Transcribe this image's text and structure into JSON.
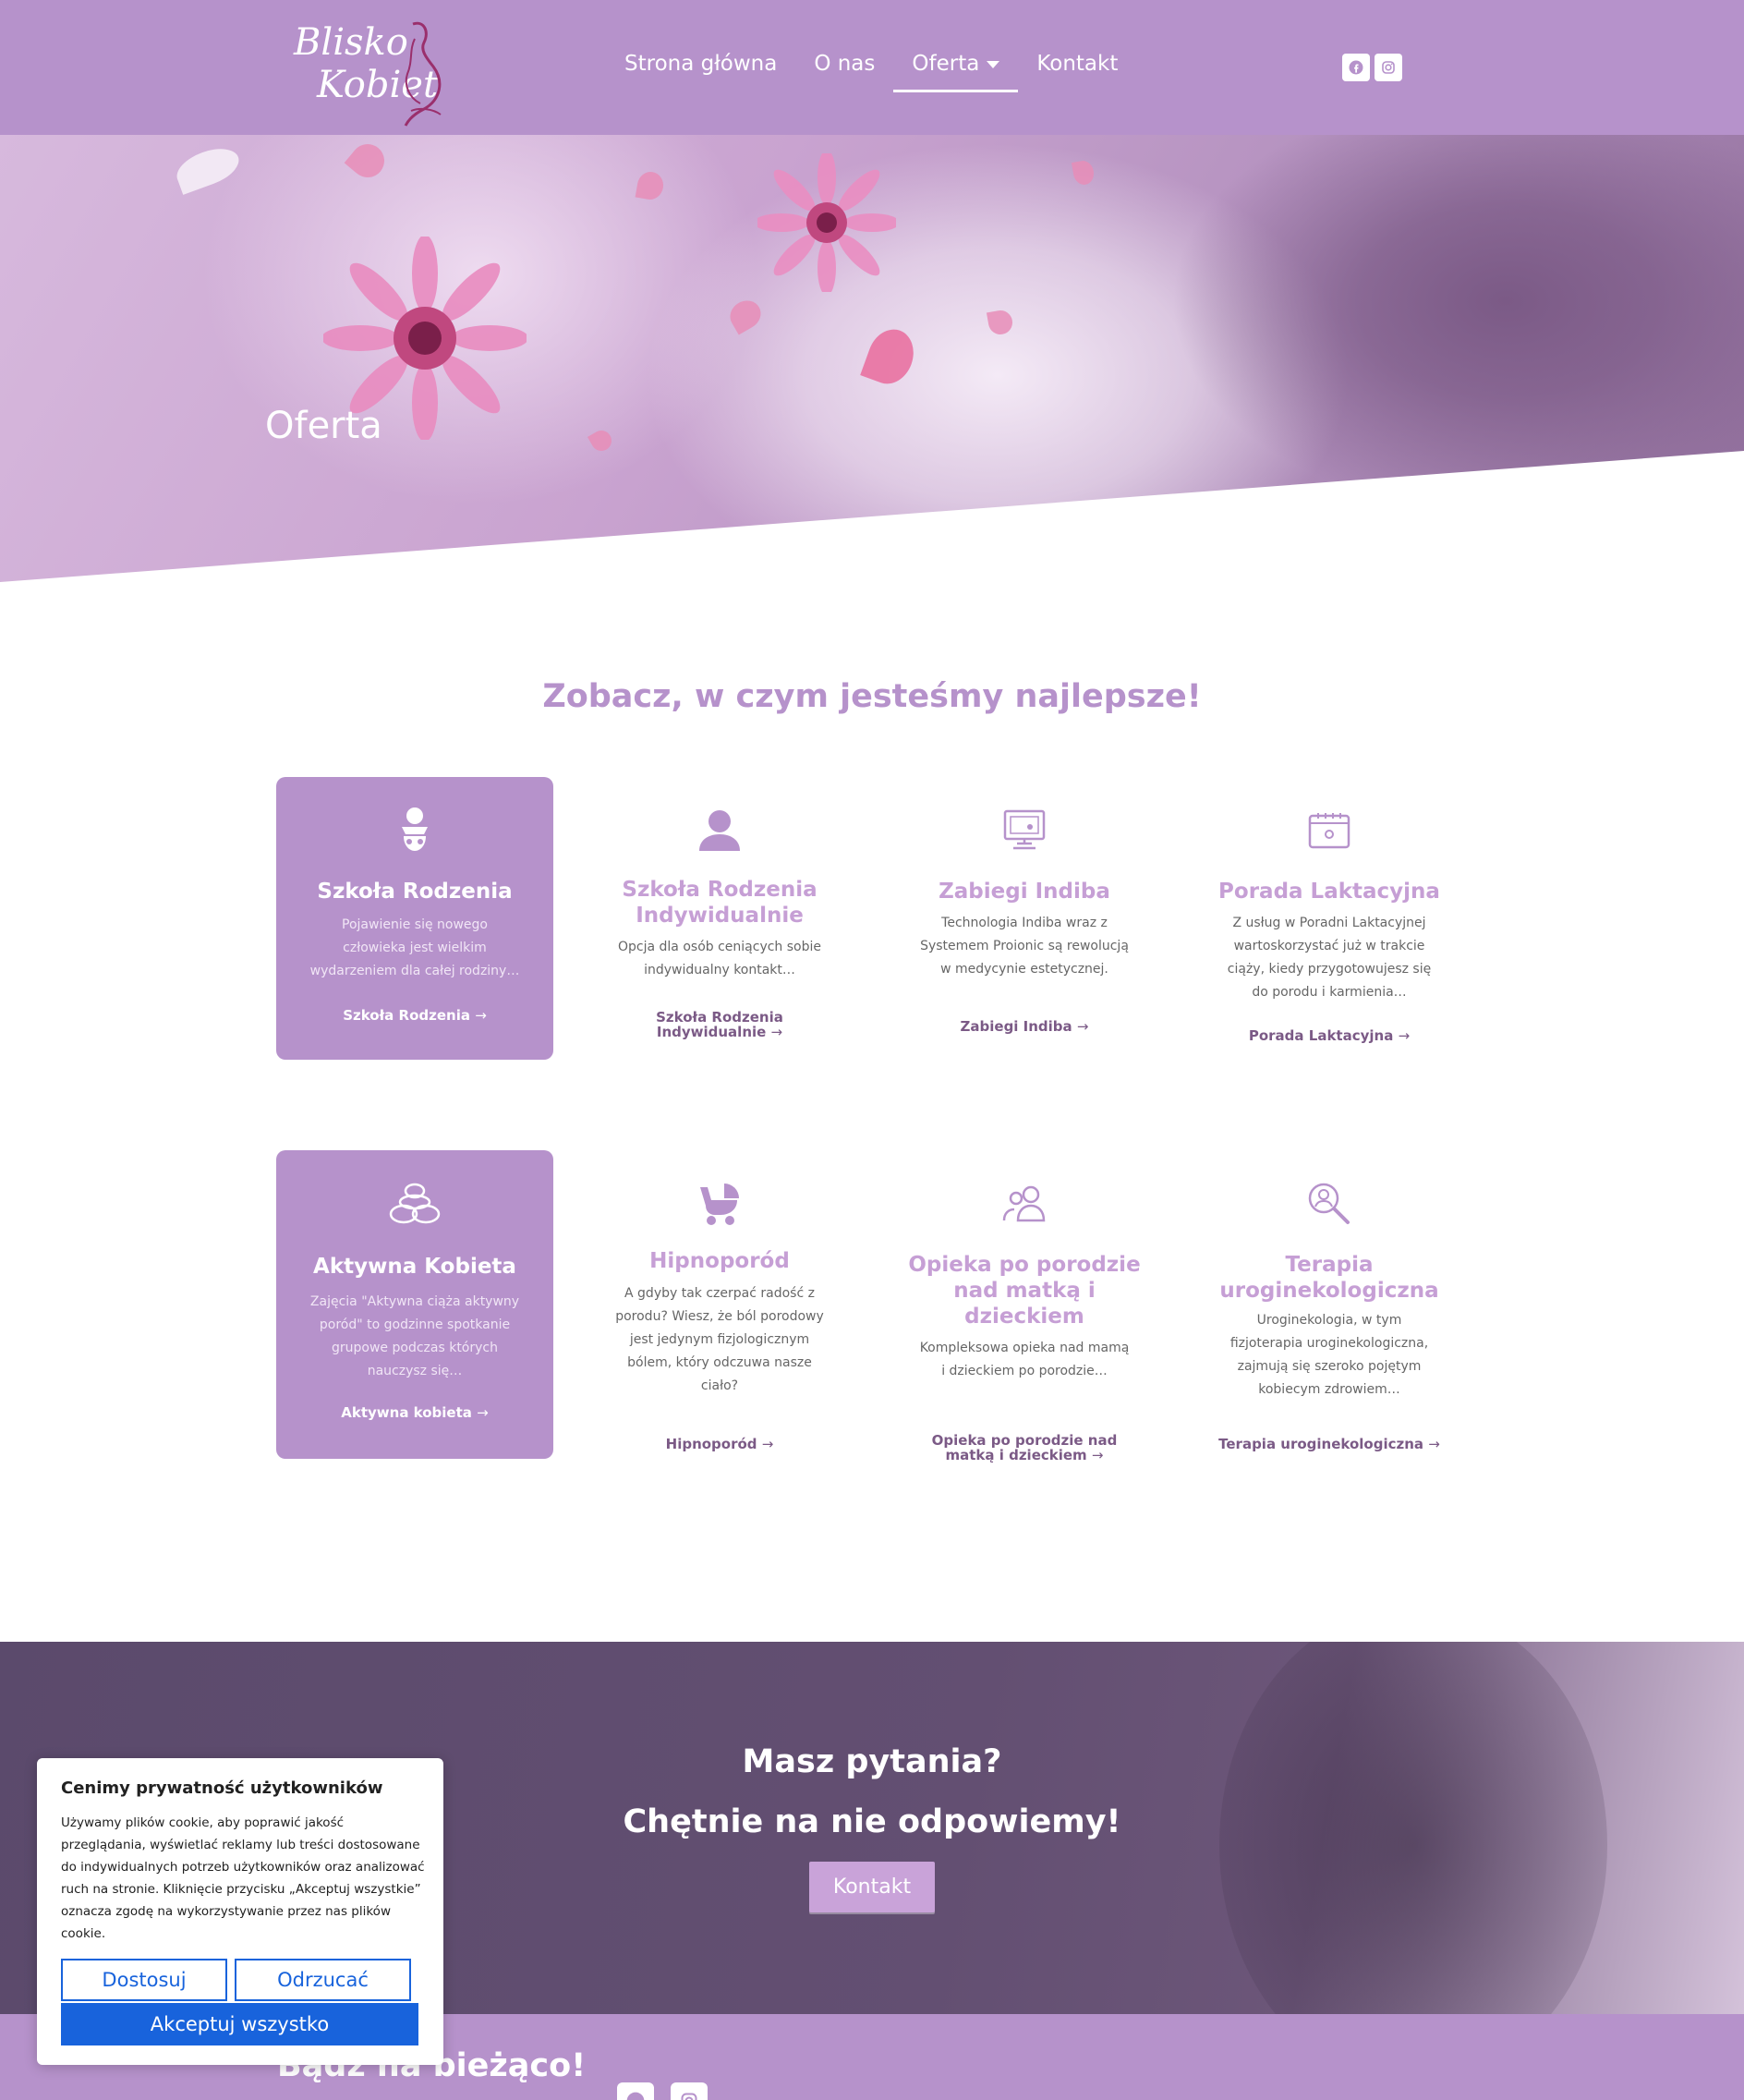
{
  "header": {
    "logo_line1": "Blisko",
    "logo_line2": "Kobiet",
    "nav": [
      "Strona główna",
      "O nas",
      "Oferta",
      "Kontakt"
    ],
    "active_nav": "Oferta",
    "social_icons": [
      "facebook-icon",
      "instagram-icon"
    ]
  },
  "hero": {
    "title": "Oferta"
  },
  "services": {
    "title": "Zobacz, w czym jesteśmy najlepsze!",
    "cards": [
      {
        "icon": "baby-icon",
        "title": "Szkoła Rodzenia",
        "desc": "Pojawienie się nowego człowieka jest wielkim wydarzeniem dla całej rodziny…",
        "link": "Szkoła Rodzenia",
        "featured": true
      },
      {
        "icon": "person-icon",
        "title": "Szkoła Rodzenia Indywidualnie",
        "desc": "Opcja dla osób ceniących sobie indywidualny kontakt…",
        "link": "Szkoła Rodzenia Indywidualnie",
        "featured": false
      },
      {
        "icon": "monitor-icon",
        "title": "Zabiegi Indiba",
        "desc": "Technologia Indiba wraz z Systemem Proionic są rewolucją w medycynie estetycznej.",
        "link": "Zabiegi Indiba",
        "featured": false
      },
      {
        "icon": "calendar-icon",
        "title": "Porada Laktacyjna",
        "desc": "Z usług w Poradni Laktacyjnej wartoskorzystać już w trakcie ciąży, kiedy przygotowujesz się do porodu i karmienia…",
        "link": "Porada Laktacyjna",
        "featured": false
      },
      {
        "icon": "stones-icon",
        "title": "Aktywna Kobieta",
        "desc": "Zajęcia \"Aktywna ciąża aktywny poród\" to godzinne spotkanie grupowe podczas których nauczysz się…",
        "link": "Aktywna kobieta",
        "featured": true
      },
      {
        "icon": "stroller-icon",
        "title": "Hipnoporód",
        "desc": "A gdyby tak czerpać radość z porodu? Wiesz, że ból porodowy jest jedynym fizjologicznym bólem, który odczuwa nasze ciało?",
        "link": "Hipnoporód",
        "featured": false
      },
      {
        "icon": "users-icon",
        "title": "Opieka po porodzie nad matką i dzieckiem",
        "desc": "Kompleksowa opieka nad mamą i dzieckiem po porodzie…",
        "link": "Opieka po porodzie nad matką i dzieckiem",
        "featured": false
      },
      {
        "icon": "search-user-icon",
        "title": "Terapia uroginekologiczna",
        "desc": "Uroginekologia, w tym fizjoterapia uroginekologiczna, zajmują się szeroko pojętym kobiecym zdrowiem…",
        "link": "Terapia uroginekologiczna",
        "featured": false
      }
    ]
  },
  "cta": {
    "line1": "Masz pytania?",
    "line2": "Chętnie na nie odpowiemy!",
    "button": "Kontakt"
  },
  "footer": {
    "title": "Bądź na bieżąco!"
  },
  "cookie": {
    "title": "Cenimy prywatność użytkowników",
    "text": "Używamy plików cookie, aby poprawić jakość przeglądania, wyświetlać reklamy lub treści dostosowane do indywidualnych potrzeb użytkowników oraz analizować ruch na stronie. Kliknięcie przycisku „Akceptuj wszystkie” oznacza zgodę na wykorzystywanie przez nas plików cookie.",
    "customize": "Dostosuj",
    "reject": "Odrzucać",
    "accept": "Akceptuj wszystko"
  },
  "colors": {
    "brand": "#b692cb",
    "brand_dark": "#7b5a86",
    "cookie_blue": "#1863dc"
  }
}
